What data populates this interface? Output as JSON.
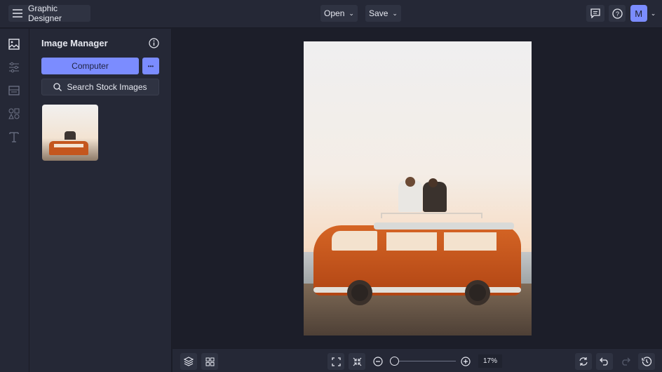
{
  "app": {
    "title": "Graphic Designer",
    "menu_icon": "hamburger-icon"
  },
  "topbar": {
    "open_label": "Open",
    "save_label": "Save",
    "avatar_initial": "M"
  },
  "panel": {
    "title": "Image Manager",
    "computer_label": "Computer",
    "more_label": "•••",
    "search_label": "Search Stock Images"
  },
  "rail": [
    "image-icon",
    "sliders-icon",
    "layout-icon",
    "shapes-icon",
    "text-icon"
  ],
  "zoom": {
    "value_label": "17%",
    "level_percent": 17
  },
  "colors": {
    "accent": "#7b8cff",
    "bg": "#1c1e29",
    "panel": "#252836"
  }
}
